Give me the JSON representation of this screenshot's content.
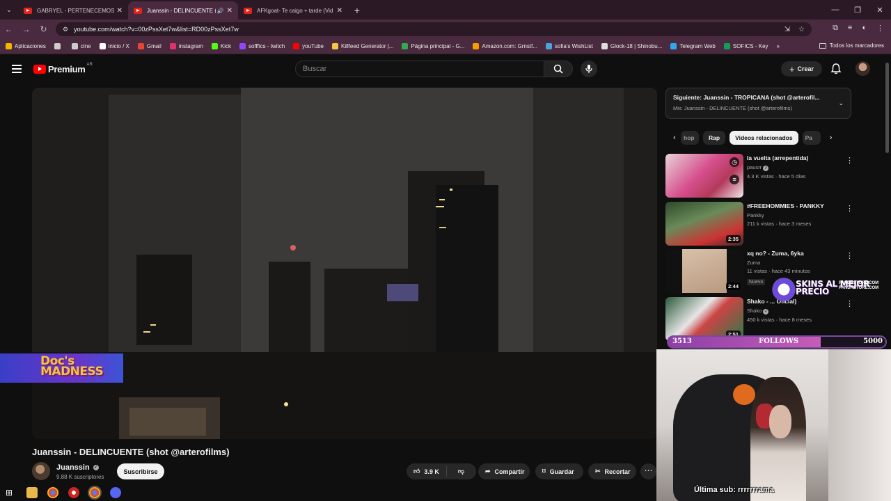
{
  "browser": {
    "tabs": [
      {
        "title": "GABRYEL - PERTENECEMOS (Vi",
        "active": false
      },
      {
        "title": "Juanssin - DELINCUENTE (sh",
        "active": true
      },
      {
        "title": "AFKgoat- Te caigo + tarde (Vid",
        "active": false
      }
    ],
    "url": "youtube.com/watch?v=00zPssXet7w&list=RD00zPssXet7w",
    "bookmarks": [
      {
        "label": "Aplicaciones",
        "icon": "apps-grid-icon",
        "color": "#f4b400"
      },
      {
        "label": "",
        "icon": "grid-icon",
        "color": "#cccccc"
      },
      {
        "label": "cine",
        "icon": "folder-icon",
        "color": "#cccccc"
      },
      {
        "label": "inicio / X",
        "icon": "x-icon",
        "color": "#ffffff"
      },
      {
        "label": "Gmail",
        "icon": "gmail-icon",
        "color": "#ea4335"
      },
      {
        "label": "instagram",
        "icon": "instagram-icon",
        "color": "#e1306c"
      },
      {
        "label": "Kick",
        "icon": "kick-icon",
        "color": "#53fc18"
      },
      {
        "label": "sofffics - twitch",
        "icon": "twitch-icon",
        "color": "#9146ff"
      },
      {
        "label": "youTube",
        "icon": "youtube-icon",
        "color": "#ff0000"
      },
      {
        "label": "Killfeed Generator |...",
        "icon": "killfeed-icon",
        "color": "#f4c542"
      },
      {
        "label": "Página principal - G...",
        "icon": "drive-icon",
        "color": "#34a853"
      },
      {
        "label": "Amazon.com: Grnstf...",
        "icon": "amazon-icon",
        "color": "#ff9900"
      },
      {
        "label": "sofia's WishList",
        "icon": "globe-icon",
        "color": "#4aa3df"
      },
      {
        "label": "Glock-18 | Shinobu...",
        "icon": "f-icon",
        "color": "#dddddd"
      },
      {
        "label": "Telegram Web",
        "icon": "telegram-icon",
        "color": "#2aabee"
      },
      {
        "label": "SOFICS - Key",
        "icon": "sheets-icon",
        "color": "#0f9d58"
      }
    ],
    "bookmarks_more": "»",
    "all_bookmarks": "Todos los marcadores"
  },
  "youtube": {
    "logo_text": "Premium",
    "country": "AR",
    "search_placeholder": "Buscar",
    "create_label": "Crear",
    "video_title": "Juanssin - DELINCUENTE (shot @arterofilms)",
    "channel_name": "Juanssin",
    "subscribers": "9.88 K suscriptores",
    "subscribe_label": "Suscribirse",
    "likes": "3.9 K",
    "share_label": "Compartir",
    "save_label": "Guardar",
    "clip_label": "Recortar",
    "next_up": "Siguiente: Juanssin - TROPICANA (shot @arterofil...",
    "mix_label": "Mix: Juanssin - DELINCUENTE (shot @arterofilms)",
    "chips": [
      "hop",
      "Rap",
      "Videos relacionados",
      "Pa"
    ],
    "recommendations": [
      {
        "title": "la vuelta (arrepentida)",
        "channel": "pausrr",
        "views": "4.3 K vistas · hace 5 días",
        "duration": "",
        "badge": ""
      },
      {
        "title": "#FREEHOMMIES - PANKKY",
        "channel": "Pankky",
        "views": "211 k vistas · hace 3 meses",
        "duration": "2:35",
        "badge": ""
      },
      {
        "title": "xq no? - Zuma, 6yka",
        "channel": "Zuma",
        "views": "11 vistas · hace 43 minutos",
        "duration": "2:44",
        "badge": "Nuevo"
      },
      {
        "title": "Shako - ... Oficial)",
        "channel": "Shako",
        "views": "450 k vistas · hace 8 meses",
        "duration": "2:51",
        "badge": ""
      }
    ]
  },
  "stream_overlay": {
    "brand_text": "Doc's MADNESS",
    "ad_big": "SKINS AL MEJOR PRECIO",
    "ad_small": "PANDASTORE.COM PANDASTORE.COM",
    "follow_current": "3513",
    "follow_label": "FOLLOWS",
    "follow_goal": "5000",
    "follow_progress": 0.7026,
    "last_sub": "Última sub: rrrrrrrama"
  }
}
